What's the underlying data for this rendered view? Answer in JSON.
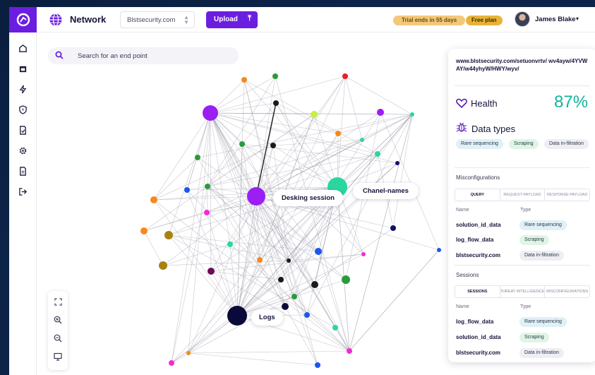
{
  "topbar": {
    "app_title": "Network",
    "domain_value": "Blstsecurity.com",
    "upload_label": "Upload",
    "trial_text": "Trial ends in 55 days",
    "plan_text": "Free plan",
    "user_name": "James Blake"
  },
  "sidebar": {
    "icons": [
      "home-icon",
      "calendar-icon",
      "bolt-icon",
      "shield-icon",
      "document-check-icon",
      "gear-icon",
      "file-icon",
      "logout-icon"
    ]
  },
  "search": {
    "placeholder": "Search for an end point"
  },
  "graph": {
    "labels": {
      "desking": "Desking session",
      "chanel": "Chanel-names",
      "logs": "Logs"
    }
  },
  "zoom_tools": [
    "expand-icon",
    "zoom-in-icon",
    "zoom-out-icon",
    "monitor-icon"
  ],
  "panel": {
    "url": "www.blstsecurity.com/setuonvrtv/ wv4ayw/4YVWAY/w44yhyW/HWY/wyv/",
    "health_label": "Health",
    "health_value": "87%",
    "data_types_label": "Data types",
    "data_types": [
      "Rare sequencing",
      "Scraping",
      "Data in-filtration"
    ],
    "misconfig": {
      "title": "Misconfigurations",
      "tabs": [
        "QUERY",
        "REQUEST PAYLOAD",
        "RESPONSE PAYLOAD"
      ],
      "col_name": "Name",
      "col_type": "Type",
      "rows": [
        {
          "name": "solution_id_data",
          "type": "Rare sequencing"
        },
        {
          "name": "log_flow_data",
          "type": "Scraping"
        },
        {
          "name": "blstsecurity.com",
          "type": "Data in-filtration"
        }
      ]
    },
    "sessions": {
      "title": "Sessions",
      "tabs": [
        "SESSIONS",
        "THREAT INTELLIGENCE",
        "MISCONFIGURATIONS"
      ],
      "col_name": "Name",
      "col_type": "Type",
      "rows": [
        {
          "name": "log_flow_data",
          "type": "Rare sequencing"
        },
        {
          "name": "solution_id_data",
          "type": "Scraping"
        },
        {
          "name": "blstsecurity.com",
          "type": "Data in-filtration"
        }
      ]
    }
  },
  "colors": {
    "brand": "#6b1ee0",
    "accent_teal": "#12b59a",
    "trial_pill": "#f4c87a",
    "plan_pill": "#e8b338"
  }
}
